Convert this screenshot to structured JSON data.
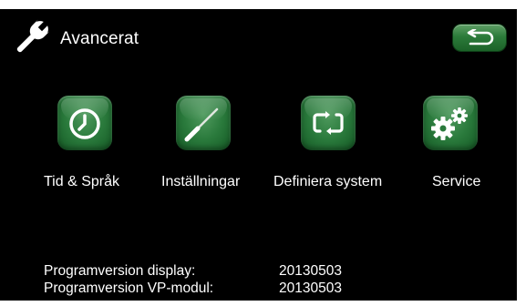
{
  "header": {
    "title": "Avancerat",
    "wrench_icon": "wrench-icon",
    "back_icon": "back-arrow-icon"
  },
  "menu": {
    "items": [
      {
        "label": "Tid & Språk",
        "icon": "clock-icon"
      },
      {
        "label": "Inställningar",
        "icon": "screwdriver-icon"
      },
      {
        "label": "Definiera system",
        "icon": "cycle-arrows-icon"
      },
      {
        "label": "Service",
        "icon": "gears-icon"
      }
    ]
  },
  "info": {
    "display_label": "Programversion display:",
    "display_value": "20130503",
    "vp_label": "Programversion VP-modul:",
    "vp_value": "20130503"
  },
  "colors": {
    "background": "#000000",
    "tile_green": "#2a7a3c",
    "text": "#ffffff"
  }
}
